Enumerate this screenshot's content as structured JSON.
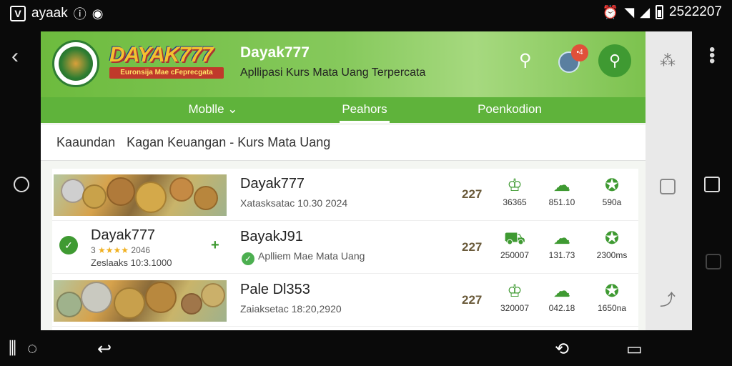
{
  "status_bar": {
    "app_name": "ayaak",
    "time": "2522207",
    "icons": [
      "signal-v-icon",
      "notification-icon",
      "message-icon",
      "alarm-icon",
      "wifi-icon",
      "cellular-icon",
      "battery-icon"
    ]
  },
  "header": {
    "brand_logo_text": "DAYAK777",
    "brand_logo_subtext": "Euronsija Mae cFeprecgata",
    "title": "Dayak777",
    "subtitle": "Apllipasi Kurs Mata Uang Terpercata",
    "badge_text": "•4"
  },
  "tabs": [
    {
      "label": "Moblle",
      "has_dropdown": true,
      "active": false
    },
    {
      "label": "Peahors",
      "active": true
    },
    {
      "label": "Poenkodion",
      "active": false
    }
  ],
  "breadcrumb": {
    "first": "Kaaundan",
    "second": "Kagan Keuangan - Kurs Mata Uang"
  },
  "rows": [
    {
      "title": "Dayak777",
      "subtitle": "Xatasksatac 10.30 2024",
      "rate": "227",
      "stats": [
        {
          "icon": "rank-icon",
          "value": "36365"
        },
        {
          "icon": "cloud-icon",
          "value": "851.10"
        },
        {
          "icon": "badge-icon",
          "value": "590a"
        }
      ]
    },
    {
      "promo_title": "Dayak777",
      "promo_rating_num": "3",
      "promo_stars": "★★★★",
      "promo_rating_count": "2046",
      "promo_date": "Zeslaaks 10:3.1000",
      "title": "BayakJ91",
      "subtitle": "Aplliem Mae Mata Uang",
      "rate": "227",
      "stats": [
        {
          "icon": "cart-icon",
          "value": "250007"
        },
        {
          "icon": "cloud-icon",
          "value": "131.73"
        },
        {
          "icon": "badge-icon",
          "value": "2300ms"
        }
      ]
    },
    {
      "title": "Pale Dl353",
      "subtitle": "Zaiaksetac 18:20,2920",
      "rate": "227",
      "stats": [
        {
          "icon": "rank-icon",
          "value": "320007"
        },
        {
          "icon": "cloud-icon",
          "value": "042.18"
        },
        {
          "icon": "badge-icon",
          "value": "1650na"
        }
      ]
    }
  ],
  "colors": {
    "header_green": "#6dbb3e",
    "tab_green": "#5fb33b",
    "accent_green": "#3f9a32",
    "badge_red": "#e0503a"
  }
}
